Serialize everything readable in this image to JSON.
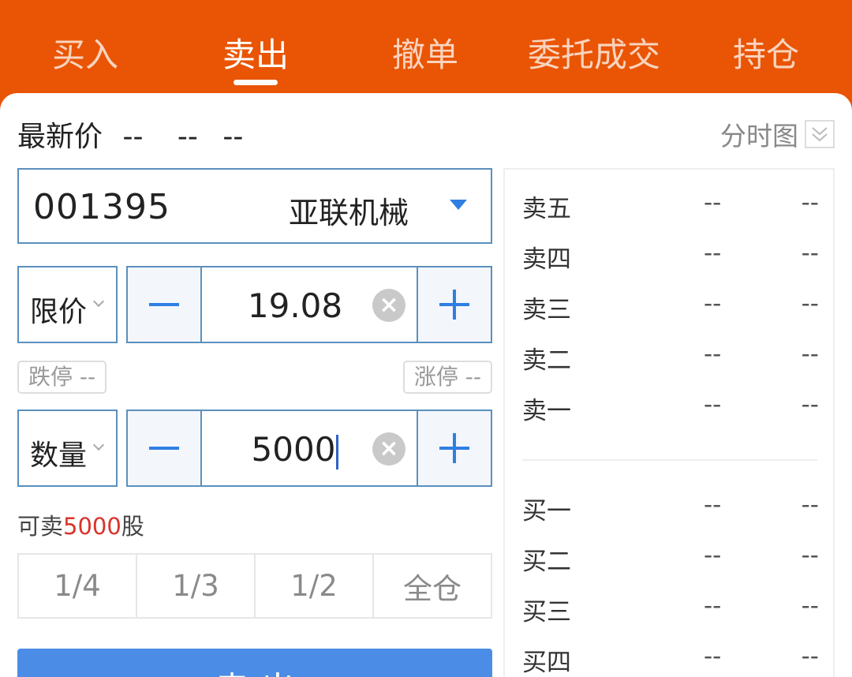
{
  "tabs": [
    {
      "label": "买入",
      "active": false
    },
    {
      "label": "卖出",
      "active": true
    },
    {
      "label": "撤单",
      "active": false
    },
    {
      "label": "委托成交",
      "active": false
    },
    {
      "label": "持仓",
      "active": false
    }
  ],
  "price_row": {
    "label": "最新价",
    "price": "--",
    "change": "--",
    "change_pct": "--"
  },
  "chart_toggle_label": "分时图",
  "stock": {
    "code": "001395",
    "name": "亚联机械"
  },
  "price_input": {
    "type_label": "限价",
    "value": "19.08"
  },
  "limits": {
    "down_label": "跌停 --",
    "up_label": "涨停 --"
  },
  "quantity_input": {
    "type_label": "数量",
    "value": "5000"
  },
  "available": {
    "prefix": "可卖",
    "amount": "5000",
    "suffix": "股"
  },
  "ratios": [
    "1/4",
    "1/3",
    "1/2",
    "全仓"
  ],
  "sell_button_label": "卖 出",
  "order_book": {
    "asks": [
      {
        "label": "卖五",
        "price": "--",
        "volume": "--"
      },
      {
        "label": "卖四",
        "price": "--",
        "volume": "--"
      },
      {
        "label": "卖三",
        "price": "--",
        "volume": "--"
      },
      {
        "label": "卖二",
        "price": "--",
        "volume": "--"
      },
      {
        "label": "卖一",
        "price": "--",
        "volume": "--"
      }
    ],
    "bids": [
      {
        "label": "买一",
        "price": "--",
        "volume": "--"
      },
      {
        "label": "买二",
        "price": "--",
        "volume": "--"
      },
      {
        "label": "买三",
        "price": "--",
        "volume": "--"
      },
      {
        "label": "买四",
        "price": "--",
        "volume": "--"
      }
    ]
  },
  "colors": {
    "brand": "#e95504",
    "accent_blue": "#2f7fe2",
    "sell_button": "#4b8de6",
    "highlight_red": "#d9332b"
  }
}
